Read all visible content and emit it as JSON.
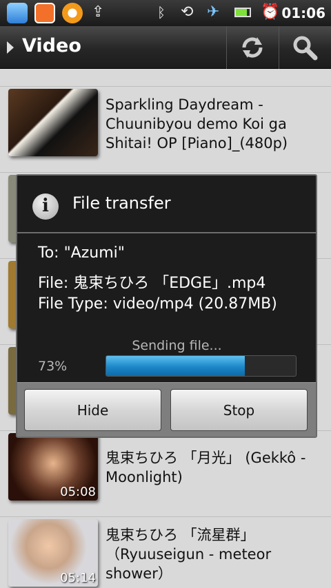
{
  "status_bar": {
    "time": "01:06",
    "icons": [
      "app-icon",
      "save-icon",
      "orange-app-icon",
      "upload-icon",
      "bluetooth-icon",
      "rotation-icon",
      "airplane-mode-icon",
      "battery-icon",
      "alarm-icon"
    ]
  },
  "action_bar": {
    "title": "Video",
    "buttons": [
      "refresh-icon",
      "search-icon"
    ]
  },
  "videos": [
    {
      "title": "Sparkling Daydream - Chuunibyou demo Koi ga Shitai! OP [Piano]_(480p)",
      "duration": ""
    },
    {
      "title": "鬼束ちひろ 「月光」 (Gekkô - Moonlight)",
      "duration": "05:08"
    },
    {
      "title": "鬼束ちひろ 「流星群」（Ryuuseigun - meteor shower）",
      "duration": "05:14"
    }
  ],
  "dialog": {
    "title": "File transfer",
    "to": "To: \"Azumi\"",
    "file": "File: 鬼束ちひろ 「EDGE」.mp4",
    "file_type": "File Type: video/mp4 (20.87MB)",
    "status": "Sending file...",
    "percent_label": "73%",
    "progress": 0.73,
    "hide_label": "Hide",
    "stop_label": "Stop"
  },
  "colors": {
    "progress": "#1c87c8",
    "dialog_bg": "#1c1c1c"
  }
}
